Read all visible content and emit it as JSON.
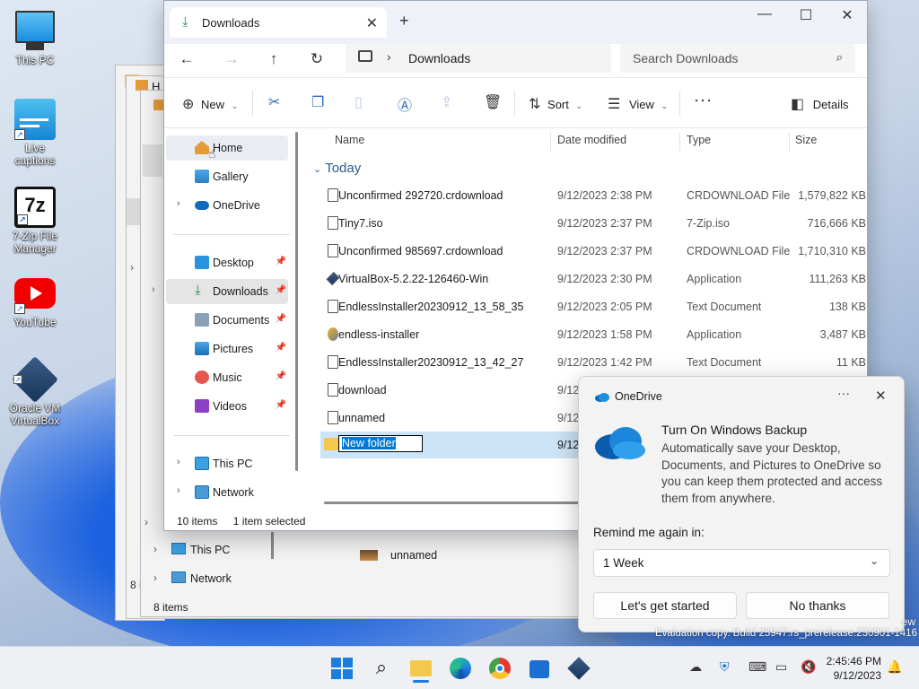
{
  "desktop": {
    "icons": [
      {
        "label": "This PC"
      },
      {
        "label": "Live captions"
      },
      {
        "label": "7-Zip File Manager"
      },
      {
        "label": "YouTube"
      },
      {
        "label": "Oracle VM VirtualBox"
      }
    ]
  },
  "background_window": {
    "title_fragment": "H",
    "sidebar": [
      "This PC",
      "Network"
    ],
    "row_name": "unnamed",
    "status": "8 items",
    "status_frag": "8 i"
  },
  "window": {
    "tab_title": "Downloads",
    "address": "Downloads",
    "search_placeholder": "Search Downloads",
    "toolbar": {
      "new": "New",
      "sort": "Sort",
      "view": "View",
      "details": "Details"
    },
    "sidebar": {
      "home": "Home",
      "gallery": "Gallery",
      "onedrive": "OneDrive",
      "desktop": "Desktop",
      "downloads": "Downloads",
      "documents": "Documents",
      "pictures": "Pictures",
      "music": "Music",
      "videos": "Videos",
      "this_pc": "This PC",
      "network": "Network"
    },
    "columns": {
      "name": "Name",
      "date": "Date modified",
      "type": "Type",
      "size": "Size"
    },
    "group": "Today",
    "files": [
      {
        "name": "Unconfirmed 292720.crdownload",
        "date": "9/12/2023 2:38 PM",
        "type": "CRDOWNLOAD File",
        "size": "1,579,822 KB"
      },
      {
        "name": "Tiny7.iso",
        "date": "9/12/2023 2:37 PM",
        "type": "7-Zip.iso",
        "size": "716,666 KB"
      },
      {
        "name": "Unconfirmed 985697.crdownload",
        "date": "9/12/2023 2:37 PM",
        "type": "CRDOWNLOAD File",
        "size": "1,710,310 KB"
      },
      {
        "name": "VirtualBox-5.2.22-126460-Win",
        "date": "9/12/2023 2:30 PM",
        "type": "Application",
        "size": "111,263 KB"
      },
      {
        "name": "EndlessInstaller20230912_13_58_35",
        "date": "9/12/2023 2:05 PM",
        "type": "Text Document",
        "size": "138 KB"
      },
      {
        "name": "endless-installer",
        "date": "9/12/2023 1:58 PM",
        "type": "Application",
        "size": "3,487 KB"
      },
      {
        "name": "EndlessInstaller20230912_13_42_27",
        "date": "9/12/2023 1:42 PM",
        "type": "Text Document",
        "size": "11 KB"
      },
      {
        "name": "download",
        "date": "9/12",
        "type": "",
        "size": ""
      },
      {
        "name": "unnamed",
        "date": "9/12",
        "type": "",
        "size": ""
      }
    ],
    "new_folder": {
      "value": "New folder",
      "date": "9/12"
    },
    "status": {
      "count": "10 items",
      "selected": "1 item selected"
    }
  },
  "toast": {
    "app": "OneDrive",
    "title": "Turn On Windows Backup",
    "body": "Automatically save your Desktop, Documents, and Pictures to OneDrive so you can keep them protected and access them from anywhere.",
    "remind_label": "Remind me again in:",
    "remind_value": "1 Week",
    "primary": "Let's get started",
    "secondary": "No thanks"
  },
  "watermark": {
    "line1": "ew",
    "line2": "Evaluation copy. Build 25947.rs_prerelease.230901-1416"
  },
  "taskbar": {
    "time": "2:45:46 PM",
    "date": "9/12/2023"
  },
  "colors": {
    "accent": "#0078d4",
    "selection": "#cce4f7",
    "folder": "#f3c84c"
  }
}
